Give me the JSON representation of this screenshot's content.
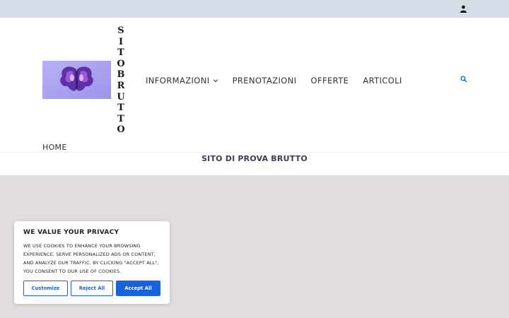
{
  "topbar": {
    "user_icon": "user-icon"
  },
  "site": {
    "title_letters": [
      "S",
      "I",
      "T",
      "O",
      "B",
      "R",
      "U",
      "T",
      "T",
      "O"
    ],
    "logo_alt": "logo",
    "home_label": "HOME",
    "tagline": "SITO DI PROVA BRUTTO"
  },
  "nav": {
    "items": [
      {
        "label": "INFORMAZIONI"
      },
      {
        "label": "PRENOTAZIONI"
      },
      {
        "label": "OFFERTE"
      },
      {
        "label": "ARTICOLI"
      }
    ],
    "search_icon": "search-icon"
  },
  "cookie": {
    "title": "WE VALUE YOUR PRIVACY",
    "text": "WE USE COOKIES TO ENHANCE YOUR BROWSING EXPERIENCE, SERVE PERSONALIZED ADS OR CONTENT, AND ANALYZE OUR TRAFFIC. BY CLICKING \"ACCEPT ALL\", YOU CONSENT TO OUR USE OF COOKIES.",
    "customize_label": "Customize",
    "reject_label": "Reject All",
    "accept_label": "Accept All"
  },
  "colors": {
    "topbar": "#d6dce6",
    "content_bg": "#e1dcdd",
    "accent": "#1863dc"
  }
}
